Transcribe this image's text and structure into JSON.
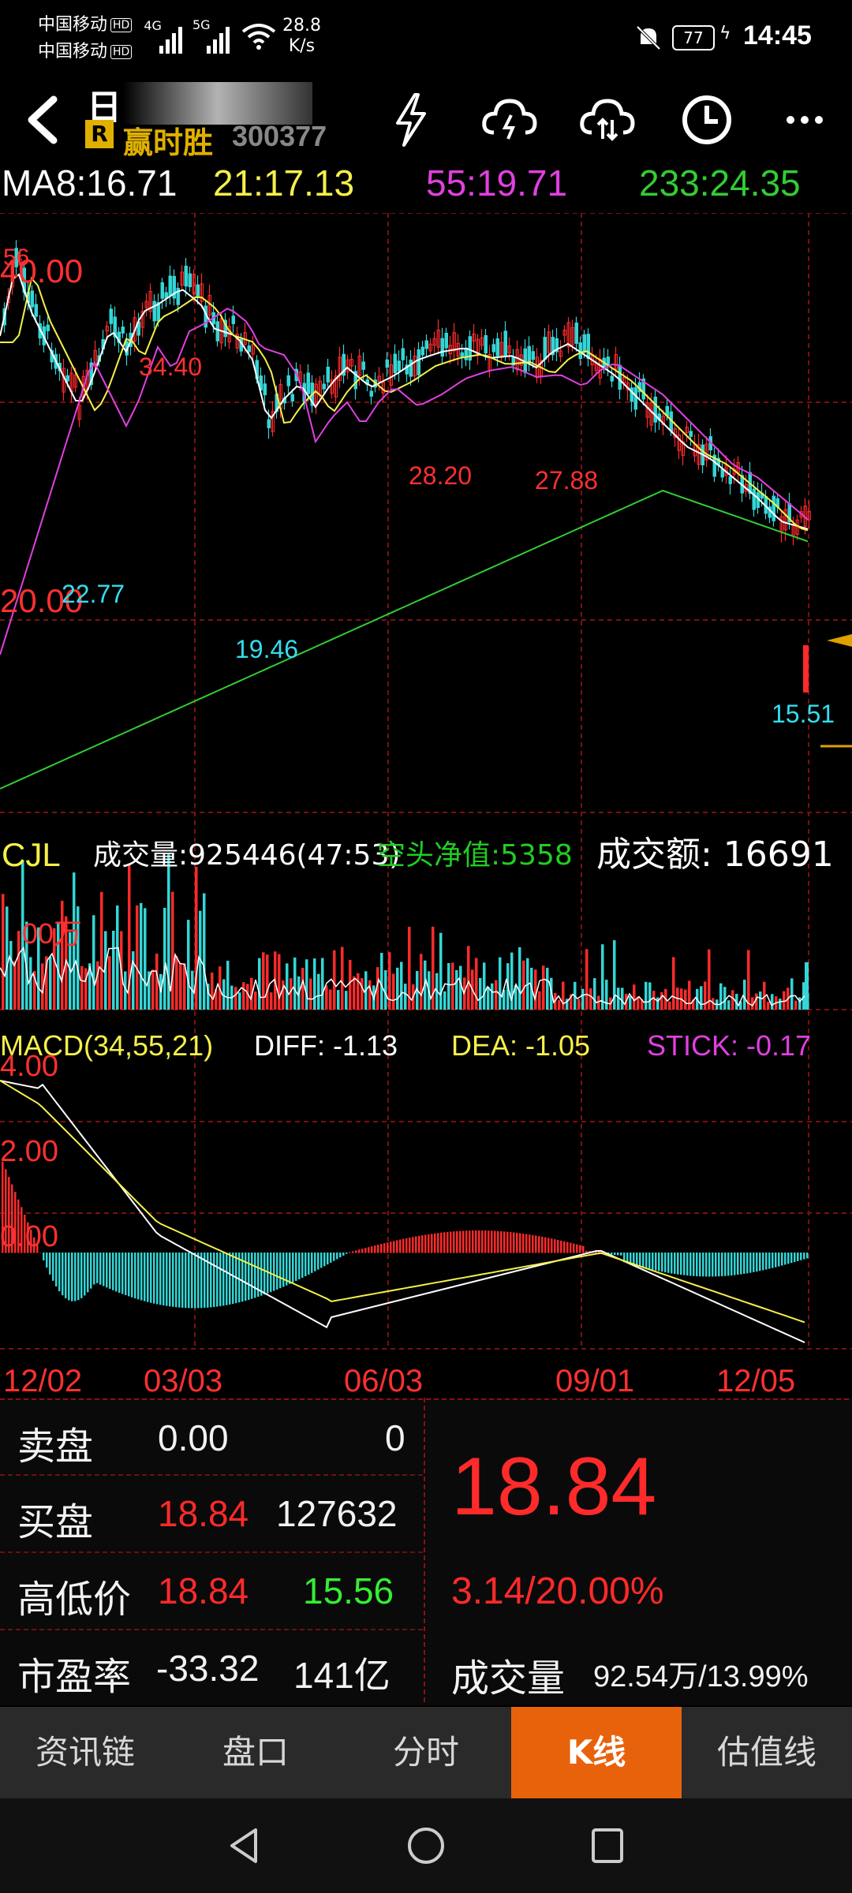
{
  "status": {
    "carrier1": "中国移动",
    "carrier2": "中国移动",
    "hd": "HD",
    "net1": "4G",
    "net2": "5G",
    "speed_value": "28.8",
    "speed_unit": "K/s",
    "battery": "77",
    "time": "14:45"
  },
  "header": {
    "period": "日",
    "badge": "R",
    "stock_name": "赢时胜",
    "stock_code": "300377",
    "icons": [
      "back-icon",
      "lightning-icon",
      "cloud-download-icon",
      "cloud-upload-icon",
      "clock-icon",
      "more-icon"
    ]
  },
  "ma": {
    "ma8": "MA8:16.71",
    "ma21": "21:17.13",
    "ma55": "55:19.71",
    "ma233": "233:24.35"
  },
  "price_chart": {
    "axis_top": "40.00",
    "axis_top_small": "56",
    "axis_mid": "20.00",
    "annotations": [
      {
        "text": "34.40",
        "color": "#ff3030"
      },
      {
        "text": "28.20",
        "color": "#ff3030"
      },
      {
        "text": "27.88",
        "color": "#ff3030"
      },
      {
        "text": "22.77",
        "color": "#33ddee"
      },
      {
        "text": "19.46",
        "color": "#33ddee"
      },
      {
        "text": "15.51",
        "color": "#33ddee"
      }
    ]
  },
  "volume": {
    "title": "CJL",
    "vol_label": "成交量:925446(47:53)",
    "net_label": "空头净值:5358",
    "amount_label": "成交额: 16691",
    "axis": "00万"
  },
  "macd": {
    "title": "MACD(34,55,21)",
    "diff": "DIFF: -1.13",
    "dea": "DEA: -1.05",
    "stick": "STICK: -0.17",
    "axis": [
      "4.00",
      "2.00",
      "0.00"
    ]
  },
  "dates": [
    "12/02",
    "03/03",
    "06/03",
    "09/01",
    "12/05"
  ],
  "panel": {
    "sell_label": "卖盘",
    "sell_price": "0.00",
    "sell_vol": "0",
    "buy_label": "买盘",
    "buy_price": "18.84",
    "buy_vol": "127632",
    "hl_label": "高低价",
    "high": "18.84",
    "low": "15.56",
    "pe_label": "市盈率",
    "pe": "-33.32",
    "mcap": "141亿",
    "price": "18.84",
    "change": "3.14/20.00%",
    "volume_label": "成交量",
    "volume_val": "92.54万/13.99%"
  },
  "tabs": [
    {
      "label": "资讯链",
      "active": false
    },
    {
      "label": "盘口",
      "active": false
    },
    {
      "label": "分时",
      "active": false
    },
    {
      "label": "K线",
      "active": true
    },
    {
      "label": "估值线",
      "active": false
    }
  ],
  "colors": {
    "up": "#ff2a2a",
    "down": "#33d6d6",
    "ma8": "#ffffff",
    "ma21": "#f5f04a",
    "ma55": "#e040e0",
    "ma233": "#33cc33",
    "active_tab": "#e8620c"
  }
}
